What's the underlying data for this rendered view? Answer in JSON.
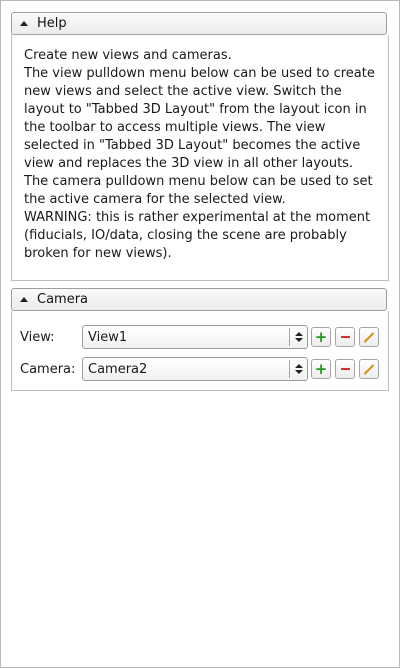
{
  "help": {
    "header_label": "Help",
    "lines": [
      "Create new views and cameras.",
      "The view pulldown menu below can be used to create new views and select the active view. Switch the layout to \"Tabbed 3D Layout\" from the layout icon in the toolbar to access multiple views. The view selected in \"Tabbed 3D Layout\" becomes the active view and replaces the 3D view in all other layouts.",
      "The camera pulldown menu below can be used to set the active camera for the selected view.",
      "WARNING: this is rather experimental at the moment (fiducials, IO/data, closing the scene are probably broken for new views)."
    ]
  },
  "camera": {
    "header_label": "Camera",
    "view_label": "View:",
    "view_value": "View1",
    "camera_label": "Camera:",
    "camera_value": "Camera2"
  },
  "colors": {
    "add": "#1e9b1e",
    "remove": "#d0302a",
    "edit": "#d8901a"
  }
}
